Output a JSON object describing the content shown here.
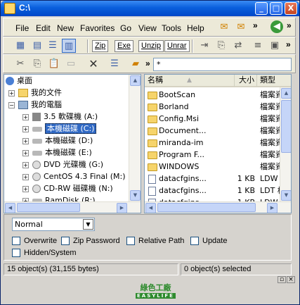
{
  "window": {
    "title": "C:\\"
  },
  "title_buttons": {
    "minimize": "_",
    "maximize": "□",
    "close": "X"
  },
  "menu": {
    "items": [
      "File",
      "Edit",
      "New",
      "Favorites",
      "Go",
      "View",
      "Tools",
      "Help"
    ],
    "overflow": "»"
  },
  "toolbar_archive": {
    "buttons": [
      "Zip",
      "Exe",
      "Unzip",
      "Unrar"
    ]
  },
  "address": {
    "value": "*"
  },
  "tree": {
    "root": "桌面",
    "items": [
      {
        "label": "我的文件",
        "icon": "documents-folder-icon",
        "level": 1
      },
      {
        "label": "我的電腦",
        "icon": "computer-icon",
        "level": 1
      },
      {
        "label": "3.5 軟碟機 (A:)",
        "icon": "floppy-drive-icon",
        "level": 2
      },
      {
        "label": "本機磁碟 (C:)",
        "icon": "hard-drive-icon",
        "level": 2,
        "selected": true
      },
      {
        "label": "本機磁碟 (D:)",
        "icon": "hard-drive-icon",
        "level": 2
      },
      {
        "label": "本機磁碟 (E:)",
        "icon": "hard-drive-icon",
        "level": 2
      },
      {
        "label": "DVD 光碟機 (G:)",
        "icon": "dvd-drive-icon",
        "level": 2
      },
      {
        "label": "CentOS 4.3 Final (M:)",
        "icon": "cd-drive-icon",
        "level": 2
      },
      {
        "label": "CD-RW 磁碟機 (N:)",
        "icon": "cdrw-drive-icon",
        "level": 2
      },
      {
        "label": "RamDisk (R:)",
        "icon": "ramdisk-icon",
        "level": 2
      }
    ]
  },
  "files": {
    "columns": [
      "名稱",
      "大小",
      "類型"
    ],
    "rows": [
      {
        "name": "BootScan",
        "size": "",
        "type": "檔案資",
        "kind": "folder"
      },
      {
        "name": "Borland",
        "size": "",
        "type": "檔案資",
        "kind": "folder"
      },
      {
        "name": "Config.Msi",
        "size": "",
        "type": "檔案資",
        "kind": "folder"
      },
      {
        "name": "Document...",
        "size": "",
        "type": "檔案資",
        "kind": "folder"
      },
      {
        "name": "miranda-im",
        "size": "",
        "type": "檔案資",
        "kind": "folder"
      },
      {
        "name": "Program F...",
        "size": "",
        "type": "檔案資",
        "kind": "folder"
      },
      {
        "name": "WINDOWS",
        "size": "",
        "type": "檔案資",
        "kind": "folder"
      },
      {
        "name": "datacfgins...",
        "size": "1 KB",
        "type": "LDW 檔",
        "kind": "file"
      },
      {
        "name": "datacfgins...",
        "size": "1 KB",
        "type": "LDT 檔",
        "kind": "file"
      },
      {
        "name": "datacfgins...",
        "size": "1 KB",
        "type": "LDW 檔",
        "kind": "file"
      }
    ]
  },
  "filter": {
    "selected": "Normal"
  },
  "options": [
    "Overwrite",
    "Zip Password",
    "Relative Path",
    "Update",
    "Hidden/System"
  ],
  "status": {
    "left": "15 object(s) (31,155 bytes)",
    "right": "0 object(s) selected"
  },
  "logo": {
    "cn": "綠色工廠",
    "en": "EASYLIFE"
  }
}
